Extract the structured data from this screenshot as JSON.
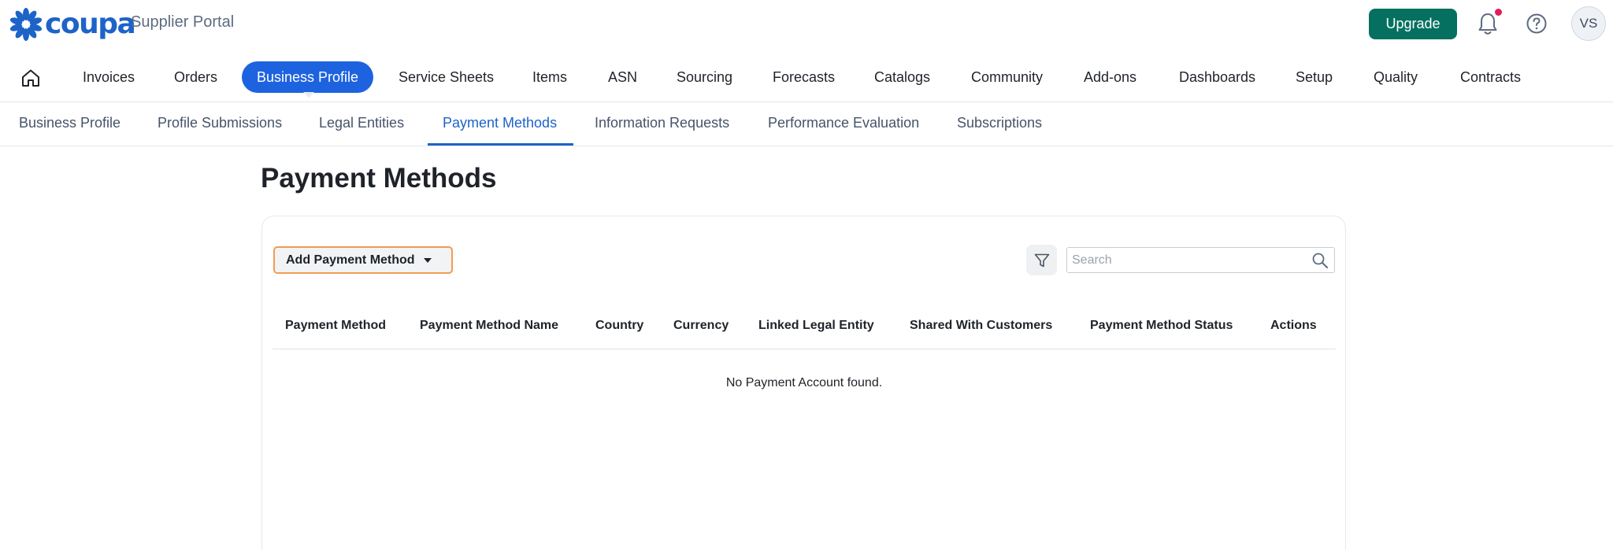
{
  "header": {
    "logo_text": "coupa",
    "portal_label": "Supplier Portal",
    "upgrade_label": "Upgrade",
    "avatar_initials": "VS"
  },
  "main_nav": [
    {
      "label": "Invoices"
    },
    {
      "label": "Orders"
    },
    {
      "label": "Business Profile",
      "active": true
    },
    {
      "label": "Service Sheets"
    },
    {
      "label": "Items"
    },
    {
      "label": "ASN"
    },
    {
      "label": "Sourcing"
    },
    {
      "label": "Forecasts"
    },
    {
      "label": "Catalogs"
    },
    {
      "label": "Community"
    },
    {
      "label": "Add-ons"
    },
    {
      "label": "Dashboards"
    },
    {
      "label": "Setup"
    },
    {
      "label": "Quality"
    },
    {
      "label": "Contracts"
    }
  ],
  "sub_nav": [
    {
      "label": "Business Profile"
    },
    {
      "label": "Profile Submissions"
    },
    {
      "label": "Legal Entities"
    },
    {
      "label": "Payment Methods",
      "active": true
    },
    {
      "label": "Information Requests"
    },
    {
      "label": "Performance Evaluation"
    },
    {
      "label": "Subscriptions"
    }
  ],
  "page": {
    "title": "Payment Methods",
    "add_button_label": "Add Payment Method",
    "search_placeholder": "Search",
    "search_value": "",
    "columns": [
      "Payment Method",
      "Payment Method Name",
      "Country",
      "Currency",
      "Linked Legal Entity",
      "Shared With Customers",
      "Payment Method Status",
      "Actions"
    ],
    "rows": [],
    "empty_message": "No Payment Account found."
  },
  "colors": {
    "brand_blue": "#1d63c8",
    "active_tab_bg": "#1d63e0",
    "upgrade_green": "#05705f",
    "notification_dot": "#e01e5a",
    "add_button_border": "#f39b52"
  },
  "icons": {
    "logo": "coupa-logo-icon",
    "notifications": "bell-icon",
    "help": "help-icon",
    "home": "home-icon",
    "filter": "filter-icon",
    "search": "search-icon",
    "dropdown": "caret-down-icon"
  }
}
